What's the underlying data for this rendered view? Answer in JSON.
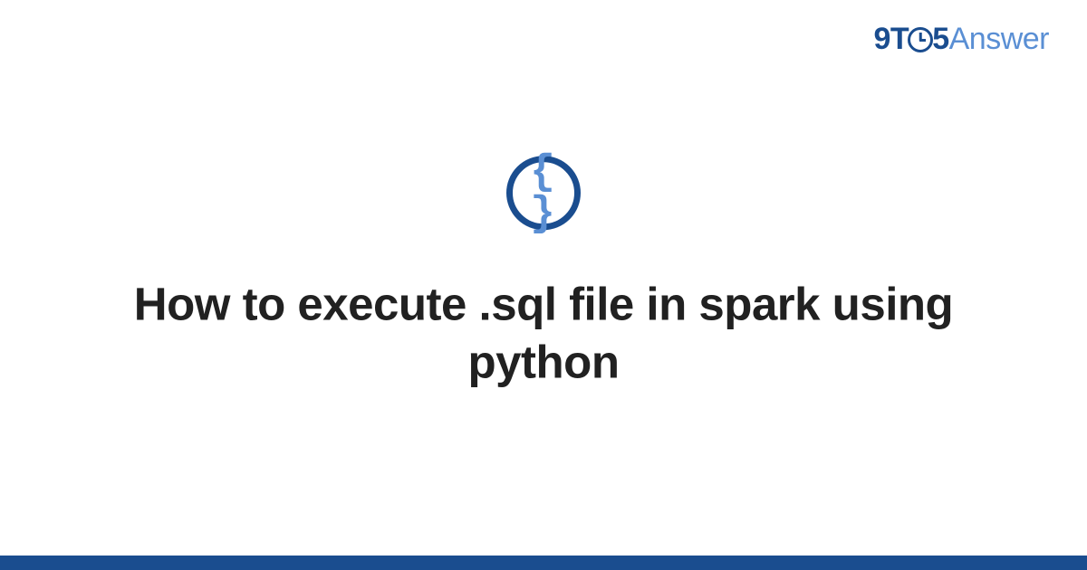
{
  "logo": {
    "nine": "9",
    "t": "T",
    "five": "5",
    "answer": "Answer"
  },
  "icon": {
    "braces": "{ }"
  },
  "main": {
    "title": "How to execute .sql file in spark using python"
  }
}
